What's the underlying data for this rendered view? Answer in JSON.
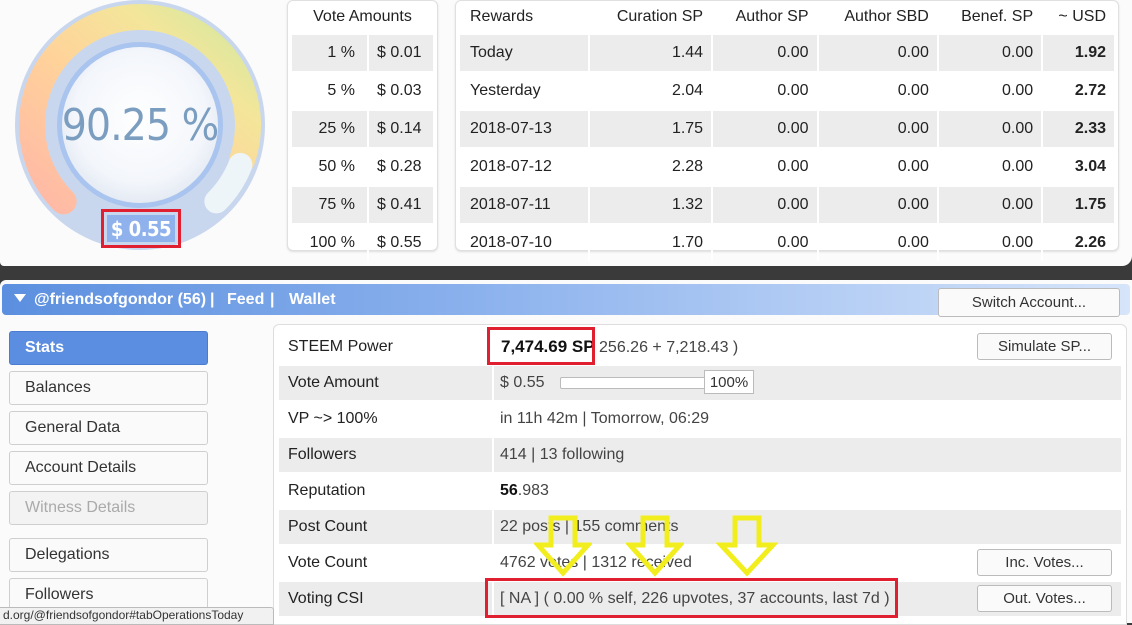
{
  "gauge": {
    "percent_label": "90.25 %",
    "value_label": "$ 0.55",
    "fill_fraction": 0.9025
  },
  "vote_amounts": {
    "header": "Vote Amounts",
    "rows": [
      {
        "pct": "1 %",
        "amt": "$ 0.01"
      },
      {
        "pct": "5 %",
        "amt": "$ 0.03"
      },
      {
        "pct": "25 %",
        "amt": "$ 0.14"
      },
      {
        "pct": "50 %",
        "amt": "$ 0.28"
      },
      {
        "pct": "75 %",
        "amt": "$ 0.41"
      },
      {
        "pct": "100 %",
        "amt": "$ 0.55"
      }
    ]
  },
  "rewards": {
    "headers": [
      "Rewards",
      "Curation SP",
      "Author SP",
      "Author SBD",
      "Benef. SP",
      "~ USD"
    ],
    "rows": [
      [
        "Today",
        "1.44",
        "0.00",
        "0.00",
        "0.00",
        "1.92"
      ],
      [
        "Yesterday",
        "2.04",
        "0.00",
        "0.00",
        "0.00",
        "2.72"
      ],
      [
        "2018-07-13",
        "1.75",
        "0.00",
        "0.00",
        "0.00",
        "2.33"
      ],
      [
        "2018-07-12",
        "2.28",
        "0.00",
        "0.00",
        "0.00",
        "3.04"
      ],
      [
        "2018-07-11",
        "1.32",
        "0.00",
        "0.00",
        "0.00",
        "1.75"
      ],
      [
        "2018-07-10",
        "1.70",
        "0.00",
        "0.00",
        "0.00",
        "2.26"
      ]
    ]
  },
  "account_bar": {
    "account": "@friendsofgondor (56)",
    "separator": "|",
    "feed": "Feed",
    "wallet": "Wallet",
    "switch_label": "Switch Account..."
  },
  "sidebar": {
    "items": [
      {
        "label": "Stats"
      },
      {
        "label": "Balances"
      },
      {
        "label": "General Data"
      },
      {
        "label": "Account Details"
      },
      {
        "label": "Witness Details"
      },
      {
        "label": "Delegations"
      },
      {
        "label": "Followers"
      }
    ]
  },
  "stats": {
    "steem_power": {
      "label": "STEEM Power",
      "main": "7,474.69 SP",
      "rest": " 256.26 + 7,218.43 )",
      "button": "Simulate SP..."
    },
    "vote_amount": {
      "label": "Vote Amount",
      "value": "$ 0.55",
      "pct": "100%"
    },
    "vp": {
      "label": "VP ~> 100%",
      "value": "in 11h 42m | Tomorrow, 06:29"
    },
    "followers": {
      "label": "Followers",
      "value": "414 | 13 following"
    },
    "reputation": {
      "label": "Reputation",
      "main": "56",
      "rest": ".983"
    },
    "post_count": {
      "label": "Post Count",
      "value": "22 posts | 155 comments"
    },
    "vote_count": {
      "label": "Vote Count",
      "value": "4762 votes | 1312 received",
      "button": "Inc. Votes..."
    },
    "voting_csi": {
      "label": "Voting CSI",
      "value": "[ NA ] ( 0.00 % self, 226 upvotes, 37 accounts, last 7d )",
      "button": "Out. Votes..."
    }
  },
  "status_url": "d.org/@friendsofgondor#tabOperationsToday",
  "colors": {
    "accent_blue": "#5b8de0",
    "highlight_red": "#e02030",
    "arrow_yellow": "#f2ee1e"
  }
}
